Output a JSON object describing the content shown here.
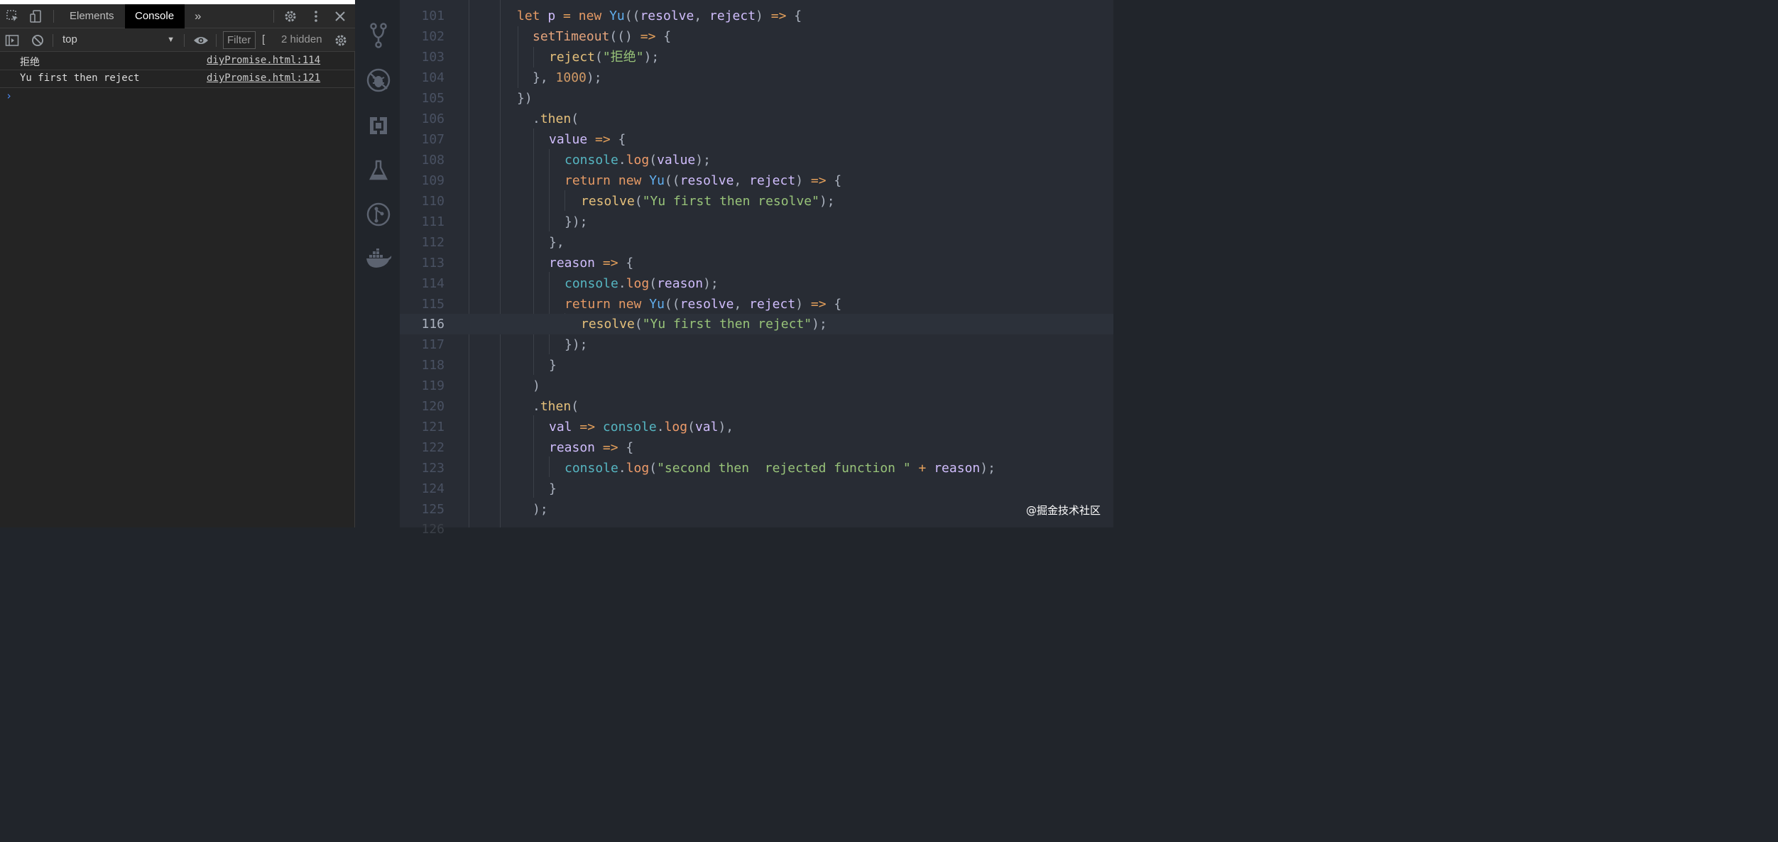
{
  "devtools": {
    "tabs": [
      "Elements",
      "Console"
    ],
    "active_tab": "Console",
    "more_tabs_glyph": "»",
    "context": "top",
    "filter_placeholder": "Filter",
    "bracket_glyph": "[",
    "hidden_count": "2 hidden",
    "messages": [
      {
        "text": "拒绝",
        "source": "diyPromise.html:114"
      },
      {
        "text": "Yu first then reject",
        "source": "diyPromise.html:121"
      }
    ],
    "prompt_glyph": "›"
  },
  "activity_bar": {
    "icons": [
      "source-control-icon",
      "debug-no-bug-icon",
      "remote-explorer-icon",
      "test-flask-icon",
      "git-graph-icon",
      "docker-icon"
    ]
  },
  "editor": {
    "current_line": 116,
    "lines": [
      {
        "n": "101",
        "code": "let p = new Yu((resolve, reject) => {"
      },
      {
        "n": "102",
        "code": "setTimeout(() => {"
      },
      {
        "n": "103",
        "code": "reject(\"拒绝\");"
      },
      {
        "n": "104",
        "code": "}, 1000);"
      },
      {
        "n": "105",
        "code": "})"
      },
      {
        "n": "106",
        "code": ".then("
      },
      {
        "n": "107",
        "code": "value => {"
      },
      {
        "n": "108",
        "code": "console.log(value);"
      },
      {
        "n": "109",
        "code": "return new Yu((resolve, reject) => {"
      },
      {
        "n": "110",
        "code": "resolve(\"Yu first then resolve\");"
      },
      {
        "n": "111",
        "code": "});"
      },
      {
        "n": "112",
        "code": "},"
      },
      {
        "n": "113",
        "code": "reason => {"
      },
      {
        "n": "114",
        "code": "console.log(reason);"
      },
      {
        "n": "115",
        "code": "return new Yu((resolve, reject) => {"
      },
      {
        "n": "116",
        "code": "resolve(\"Yu first then reject\");"
      },
      {
        "n": "117",
        "code": "});"
      },
      {
        "n": "118",
        "code": "}"
      },
      {
        "n": "119",
        "code": ")"
      },
      {
        "n": "120",
        "code": ".then("
      },
      {
        "n": "121",
        "code": "val => console.log(val),"
      },
      {
        "n": "122",
        "code": "reason => {"
      },
      {
        "n": "123",
        "code": "console.log(\"second then  rejected function \" + reason);"
      },
      {
        "n": "124",
        "code": "}"
      },
      {
        "n": "125",
        "code": ");"
      }
    ]
  },
  "watermark": "@掘金技术社区",
  "colors": {
    "keyword": "#e5c07b",
    "string": "#98c379",
    "function": "#61afef",
    "number": "#d19a66",
    "line_highlight": "#2c313a"
  }
}
